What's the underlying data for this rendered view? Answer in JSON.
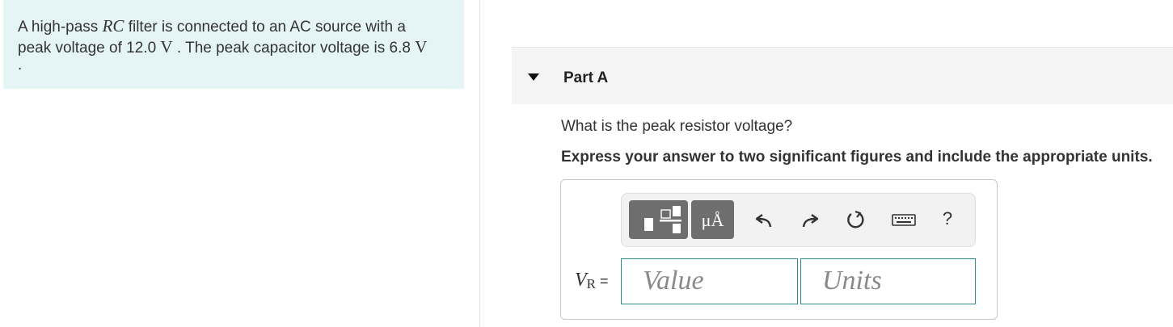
{
  "problem": {
    "text1": "A high-pass ",
    "rc": "RC",
    "text2": " filter is connected to an AC source with a",
    "text3": "peak voltage of 12.0 ",
    "unit_v1": "V",
    "text4": " . The peak capacitor voltage is 6.8 ",
    "unit_v2": "V",
    "text5": "."
  },
  "part": {
    "title": "Part A"
  },
  "question": "What is the peak resistor voltage?",
  "instruction": "Express your answer to two significant figures and include the appropriate units.",
  "toolbar": {
    "units_label": "μÅ",
    "help_label": "?",
    "icons": [
      "templates-icon",
      "undo-icon",
      "redo-icon",
      "reset-icon",
      "keyboard-icon"
    ]
  },
  "answer": {
    "var_main": "V",
    "var_sub": "R",
    "equals": " =",
    "value_placeholder": "Value",
    "units_placeholder": "Units"
  }
}
